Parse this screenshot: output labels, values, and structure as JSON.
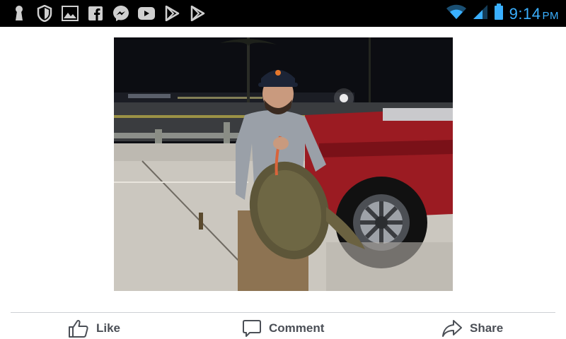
{
  "status_bar": {
    "time": "9:14",
    "ampm": "PM",
    "left_icons": [
      "keyhole-icon",
      "shield-icon",
      "gallery-icon",
      "facebook-icon",
      "messenger-icon",
      "youtube-icon",
      "play-store-icon",
      "play-store-icon"
    ],
    "right_icons": [
      "wifi-icon",
      "signal-icon",
      "battery-icon"
    ],
    "accent_color": "#3ab0ff"
  },
  "post": {
    "photo_icon": "post-photo"
  },
  "actions": {
    "like_label": "Like",
    "comment_label": "Comment",
    "share_label": "Share"
  }
}
